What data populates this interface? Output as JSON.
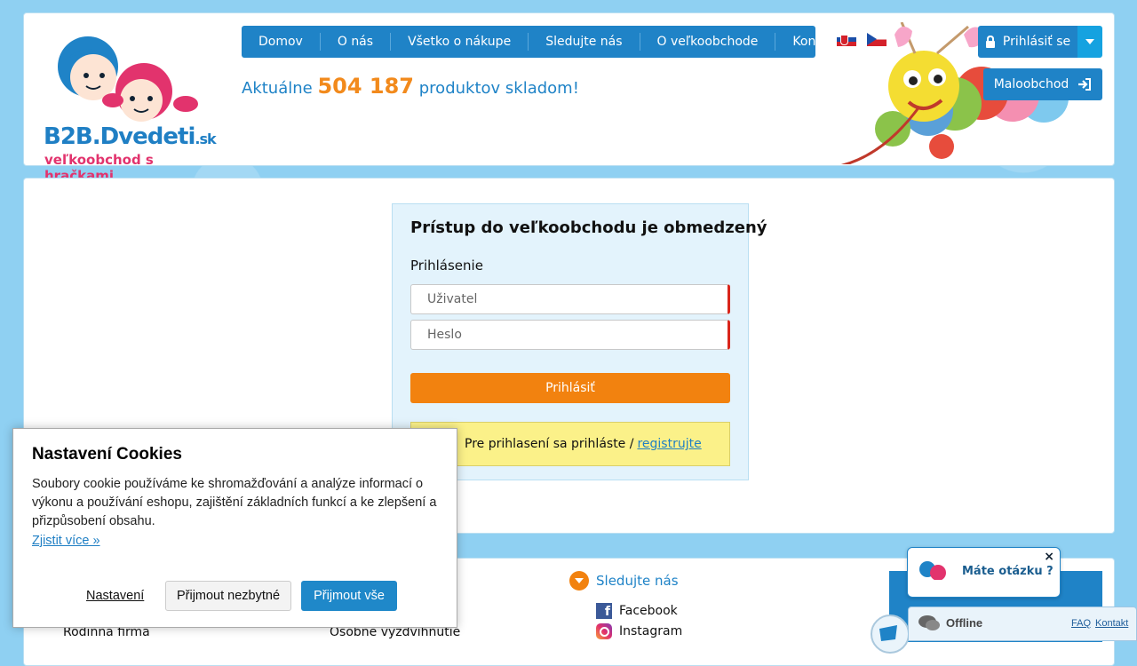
{
  "logo": {
    "brand": "B2B.Dvedeti",
    "tld": ".sk",
    "tagline": "veľkoobchod s hračkami"
  },
  "nav": {
    "items": [
      "Domov",
      "O nás",
      "Všetko o nákupe",
      "Sledujte nás",
      "O veľkoobchode",
      "Kontakty"
    ]
  },
  "stock": {
    "prefix": "Aktuálne",
    "count": "504 187",
    "suffix": "produktov skladom!"
  },
  "header": {
    "login_label": "Prihlásiť se",
    "retail_label": "Maloobchod"
  },
  "login": {
    "title": "Prístup do veľkoobchodu je obmedzený",
    "subtitle": "Prihlásenie",
    "user_placeholder": "Uživatel",
    "password_placeholder": "Heslo",
    "submit_label": "Prihlásiť",
    "notice_text": "Pre prihlasení sa prihláste /",
    "register_link": "registrujte"
  },
  "footer": {
    "follow_title": "Sledujte nás",
    "facebook": "Facebook",
    "instagram": "Instagram",
    "col1_item": "Rodinná firma",
    "col2_item": "Osobné vyzdvihnutie"
  },
  "cookies": {
    "title": "Nastavení Cookies",
    "text": "Soubory cookie používáme ke shromažďování a analýze informací o výkonu a používání eshopu, zajištění základních funkcí a ke zlepšení a přizpůsobení obsahu.",
    "more_link": "Zjistit více »",
    "settings_label": "Nastavení",
    "necessary_label": "Přijmout nezbytné",
    "accept_all_label": "Přijmout vše"
  },
  "chat": {
    "question": "Máte otázku ?",
    "close": "×",
    "status": "Offline",
    "faq": "FAQ",
    "contact": "Kontakt"
  },
  "colors": {
    "primary": "#1f83c7",
    "accent": "#f2820f",
    "notice": "#fbf189",
    "pink": "#e2336d"
  }
}
